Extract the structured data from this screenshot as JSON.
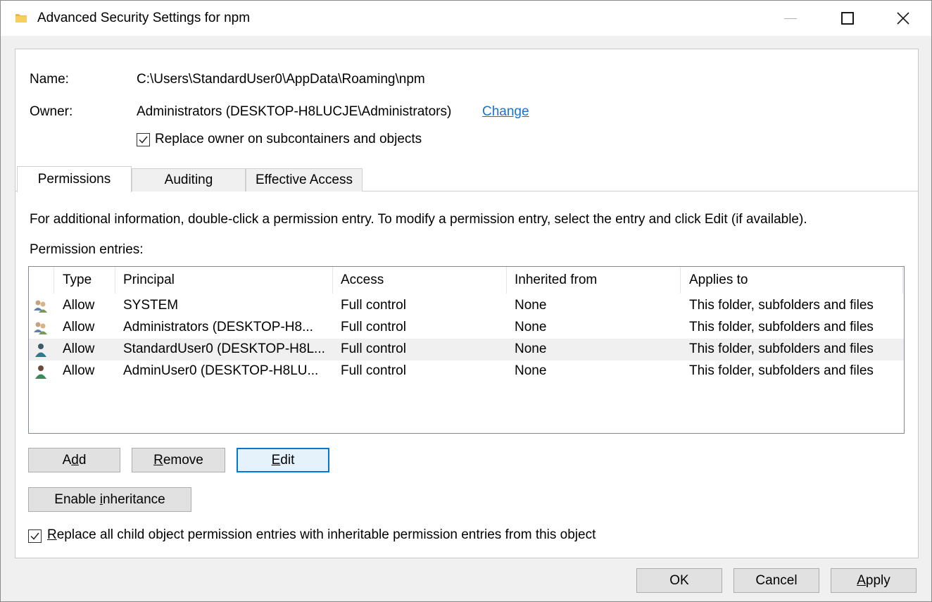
{
  "window": {
    "title": "Advanced Security Settings for npm",
    "icon": "folder-icon"
  },
  "object": {
    "name_label": "Name:",
    "name_value": "C:\\Users\\StandardUser0\\AppData\\Roaming\\npm",
    "owner_label": "Owner:",
    "owner_value": "Administrators (DESKTOP-H8LUCJE\\Administrators)",
    "change_link": "Change",
    "replace_owner_label": "Replace owner on subcontainers and objects",
    "replace_owner_checked": true
  },
  "tabs": [
    {
      "label": "Permissions",
      "active": true
    },
    {
      "label": "Auditing",
      "active": false
    },
    {
      "label": "Effective Access",
      "active": false
    }
  ],
  "info_text": "For additional information, double-click a permission entry. To modify a permission entry, select the entry and click Edit (if available).",
  "entries_label": "Permission entries:",
  "table": {
    "columns": [
      "Type",
      "Principal",
      "Access",
      "Inherited from",
      "Applies to"
    ],
    "rows": [
      {
        "icon": "group-icon",
        "type": "Allow",
        "principal": "SYSTEM",
        "access": "Full control",
        "inherited_from": "None",
        "applies_to": "This folder, subfolders and files",
        "selected": false
      },
      {
        "icon": "group-icon",
        "type": "Allow",
        "principal": "Administrators (DESKTOP-H8...",
        "access": "Full control",
        "inherited_from": "None",
        "applies_to": "This folder, subfolders and files",
        "selected": false
      },
      {
        "icon": "user-icon",
        "type": "Allow",
        "principal": "StandardUser0 (DESKTOP-H8L...",
        "access": "Full control",
        "inherited_from": "None",
        "applies_to": "This folder, subfolders and files",
        "selected": true
      },
      {
        "icon": "user-icon",
        "type": "Allow",
        "principal": "AdminUser0 (DESKTOP-H8LU...",
        "access": "Full control",
        "inherited_from": "None",
        "applies_to": "This folder, subfolders and files",
        "selected": false
      }
    ]
  },
  "buttons": {
    "add_pre": "A",
    "add_key": "d",
    "add_post": "d",
    "remove_pre": "",
    "remove_key": "R",
    "remove_post": "emove",
    "edit_pre": "",
    "edit_key": "E",
    "edit_post": "dit",
    "inherit_pre": "Enable ",
    "inherit_key": "i",
    "inherit_post": "nheritance",
    "ok": "OK",
    "cancel": "Cancel",
    "apply_pre": "",
    "apply_key": "A",
    "apply_post": "pply"
  },
  "replace_child": {
    "pre": "",
    "key": "R",
    "post": "eplace all child object permission entries with inheritable permission entries from this object",
    "checked": true
  },
  "colors": {
    "link": "#1a73c7",
    "focus_border": "#0078d7",
    "selected_row": "#f0f0f0"
  }
}
